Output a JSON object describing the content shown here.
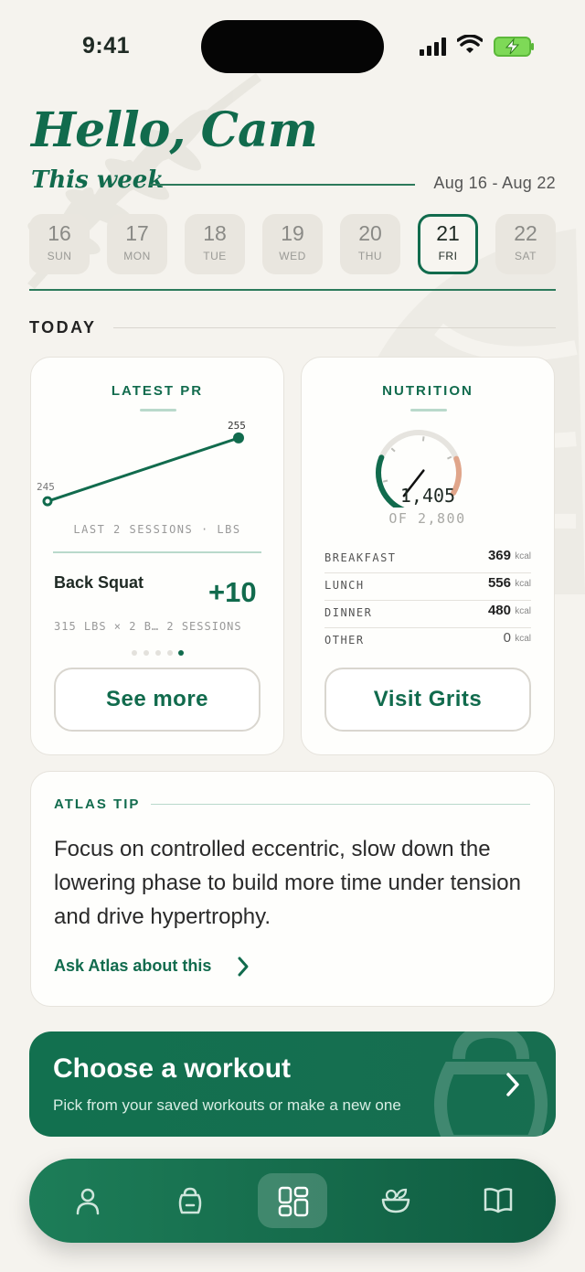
{
  "status": {
    "time": "9:41"
  },
  "header": {
    "greeting": "Hello, Cam",
    "week_label": "This week",
    "date_range": "Aug 16 - Aug 22"
  },
  "days": [
    {
      "num": "16",
      "name": "SUN"
    },
    {
      "num": "17",
      "name": "MON"
    },
    {
      "num": "18",
      "name": "TUE"
    },
    {
      "num": "19",
      "name": "WED"
    },
    {
      "num": "20",
      "name": "THU"
    },
    {
      "num": "21",
      "name": "FRI",
      "selected": true
    },
    {
      "num": "22",
      "name": "SAT"
    }
  ],
  "today_label": "TODAY",
  "latest_pr": {
    "title": "LATEST PR",
    "chart_data": {
      "type": "line",
      "x": [
        1,
        2
      ],
      "values": [
        245,
        255
      ],
      "data_labels": [
        "245",
        "255"
      ],
      "xlabel": "LAST 2 SESSIONS · LBS"
    },
    "exercise": "Back Squat",
    "delta": "+10",
    "detail": "315 LBS × 2 B… 2 SESSIONS",
    "pager": {
      "pages": 5,
      "current": 5
    },
    "button": "See more"
  },
  "nutrition": {
    "title": "NUTRITION",
    "consumed": "1,405",
    "goal_text": "OF 2,800",
    "progress_fraction": 0.502,
    "meals": [
      {
        "name": "BREAKFAST",
        "value": "369",
        "unit": "kcal"
      },
      {
        "name": "LUNCH",
        "value": "556",
        "unit": "kcal"
      },
      {
        "name": "DINNER",
        "value": "480",
        "unit": "kcal"
      },
      {
        "name": "OTHER",
        "value": "0",
        "unit": "kcal"
      }
    ],
    "button": "Visit Grits"
  },
  "tip": {
    "title": "ATLAS TIP",
    "body": "Focus on controlled eccentric, slow down the lowering phase to build more time under tension and drive hypertrophy.",
    "link": "Ask Atlas about this"
  },
  "workout": {
    "title": "Choose a workout",
    "subtitle": "Pick from your saved workouts or make a new one"
  },
  "tabbar": [
    {
      "icon": "person-icon"
    },
    {
      "icon": "kettlebell-icon"
    },
    {
      "icon": "dashboard-icon",
      "active": true
    },
    {
      "icon": "food-bowl-icon"
    },
    {
      "icon": "book-icon"
    }
  ],
  "colors": {
    "brand": "#116b4d",
    "background": "#f5f3ee",
    "gauge_warn": "#e0a58a"
  }
}
